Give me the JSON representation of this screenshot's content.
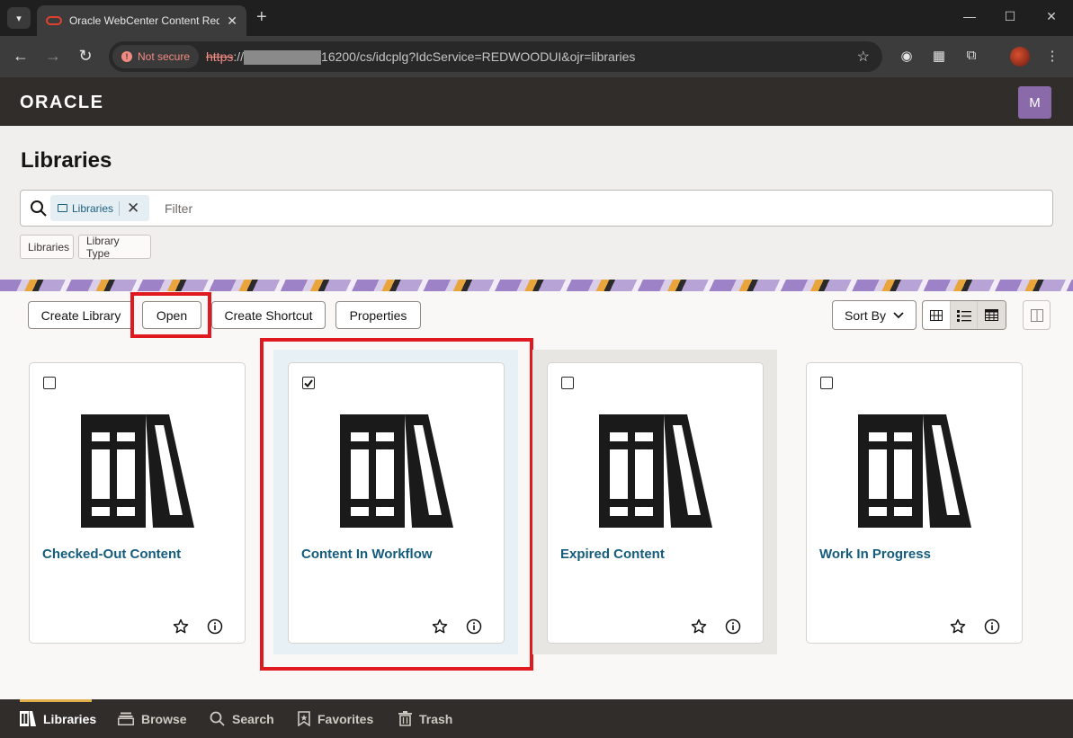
{
  "browser": {
    "tab_title": "Oracle WebCenter Content Redwood",
    "security_label": "Not secure",
    "url_scheme": "https",
    "url_sep": "://",
    "url_rest": "16200/cs/idcplg?IdcService=REDWOODUI&ojr=libraries"
  },
  "header": {
    "logo": "ORACLE",
    "avatar_initial": "M",
    "avatar_color": "#8a6aa8"
  },
  "page": {
    "title": "Libraries",
    "search_chip": "Libraries",
    "filter_placeholder": "Filter",
    "facets": [
      "Libraries",
      "Library Type"
    ]
  },
  "toolbar": {
    "create_library": "Create Library",
    "open": "Open",
    "create_shortcut": "Create Shortcut",
    "properties": "Properties",
    "sort_by": "Sort By"
  },
  "libraries": [
    {
      "name": "Checked-Out Content",
      "checked": false
    },
    {
      "name": "Content In Workflow",
      "checked": true
    },
    {
      "name": "Expired Content",
      "checked": false
    },
    {
      "name": "Work In Progress",
      "checked": false
    }
  ],
  "bottom_nav": {
    "libraries": "Libraries",
    "browse": "Browse",
    "search": "Search",
    "favorites": "Favorites",
    "trash": "Trash"
  },
  "colors": {
    "highlight": "#e0181f",
    "link": "#145c7e",
    "selected_card_bg": "#e6f0f5"
  }
}
